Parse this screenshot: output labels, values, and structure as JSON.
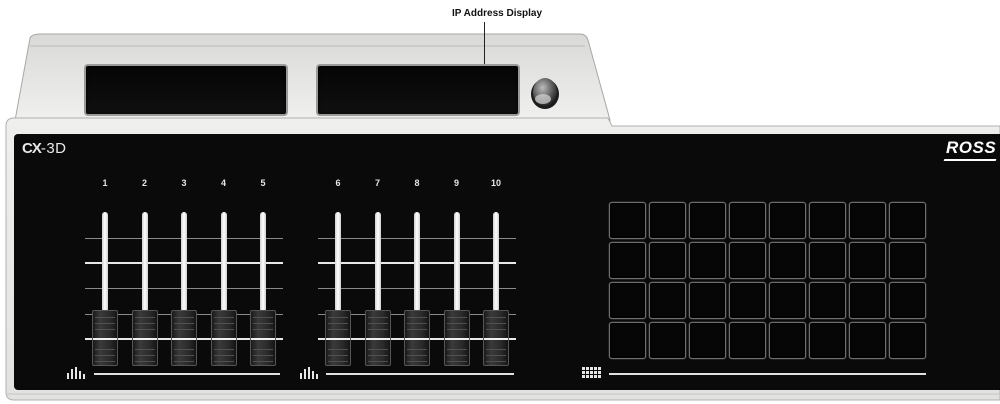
{
  "callout": {
    "label": "IP Address Display"
  },
  "panel": {
    "model_logo": {
      "bold": "CX",
      "rest": "-3D"
    },
    "brand_logo": "ROSS"
  },
  "fader_banks": [
    {
      "channels": [
        "1",
        "2",
        "3",
        "4",
        "5"
      ]
    },
    {
      "channels": [
        "6",
        "7",
        "8",
        "9",
        "10"
      ]
    }
  ],
  "icons": {
    "display_knob": "knob-icon",
    "fader_bank_icon": "level-meter-icon",
    "grid_icon": "keypad-grid-icon"
  },
  "button_grid": {
    "rows": 4,
    "columns": 8
  },
  "colors": {
    "panel": "#0a0a0a",
    "housing": "#ebebea",
    "fader_slot": "#ffffff",
    "button_border": "#6e6e6e"
  }
}
